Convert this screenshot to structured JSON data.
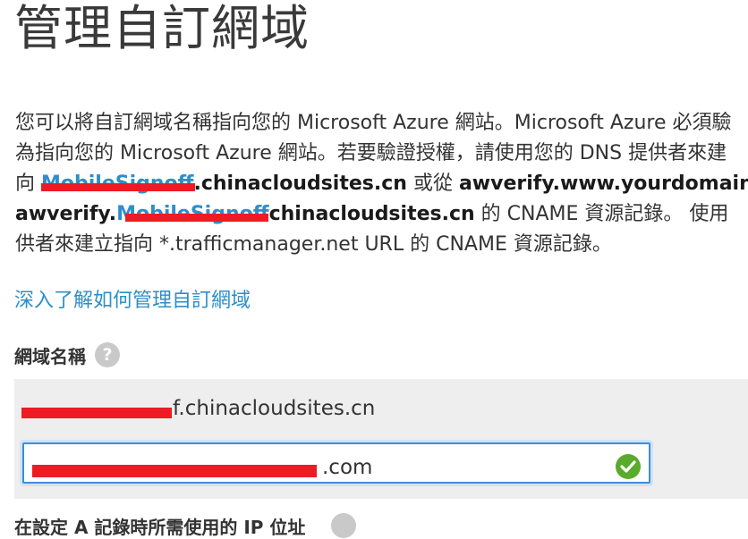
{
  "page": {
    "title": "管理自訂網域"
  },
  "description": {
    "line1": "您可以將自訂網域名稱指向您的 Microsoft Azure 網站。Microsoft Azure 必須驗",
    "line2": "為指向您的 Microsoft Azure 網站。若要驗證授權，請使用您的 DNS 提供者來建",
    "line3_prefix": "向 ",
    "line3_link": "MobileSignoff",
    "line3_bold": ".chinacloudsites.cn",
    "line3_mid": " 或從 ",
    "line3_bold2": "awverify.www.yourdomain",
    "line4_bold": "awverify.",
    "line4_link": "MobileSignoff",
    "line4_bold2": "chinacloudsites.cn",
    "line4_rest": " 的 CNAME 資源記錄。 使用",
    "line5": "供者來建立指向 *.trafficmanager.net URL 的 CNAME 資源記錄。"
  },
  "learn_more": "深入了解如何管理自訂網域",
  "domain_field": {
    "label": "網域名稱",
    "help_glyph": "?",
    "existing_value": "f.chinacloudsites.cn",
    "input_value": ".com"
  },
  "next_label": "在設定 A 記錄時所需使用的 IP 位址",
  "colors": {
    "accent": "#2e8ec9",
    "check": "#5aaa2c",
    "redaction": "#ee1b24"
  }
}
